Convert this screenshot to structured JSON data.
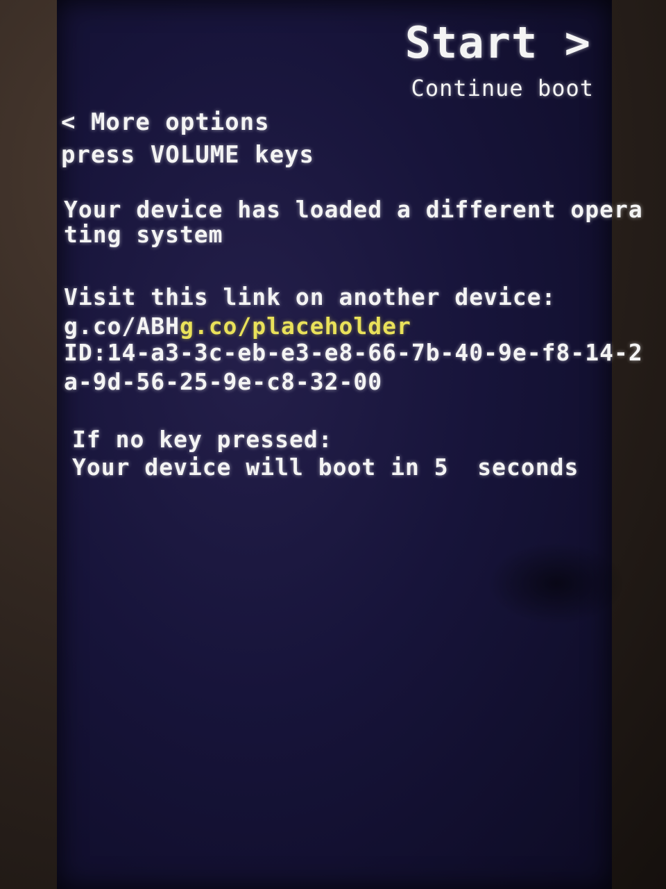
{
  "start": {
    "title": "Start >",
    "subtitle": "Continue boot"
  },
  "options": {
    "more_label": "< More options",
    "hint": "press VOLUME keys"
  },
  "message": {
    "line1": "Your device has loaded a different opera",
    "line2": "ting system"
  },
  "link": {
    "label": "Visit this link on another device:",
    "prefix": "g.co/ABH",
    "url": "g.co/placeholder"
  },
  "device_id": {
    "line1": "ID:14-a3-3c-eb-e3-e8-66-7b-40-9e-f8-14-2",
    "line2": "a-9d-56-25-9e-c8-32-00"
  },
  "countdown": {
    "line1": "If no key pressed:",
    "line2": "Your device will boot in 5  seconds"
  }
}
